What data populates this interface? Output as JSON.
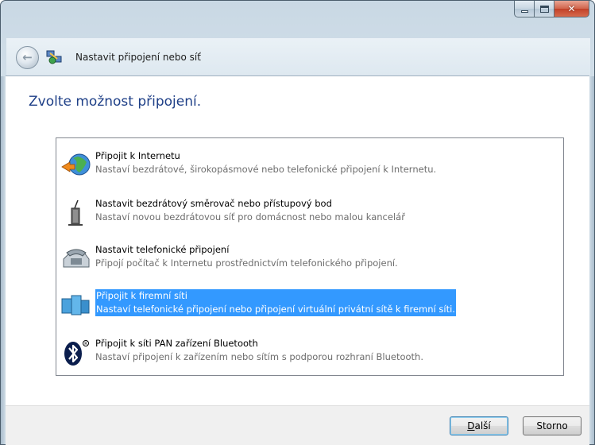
{
  "window": {
    "title": "Nastavit připojení nebo síť",
    "buttons": {
      "minimize": "minimize",
      "maximize": "maximize",
      "close": "close"
    }
  },
  "heading": "Zvolte možnost připojení.",
  "options": [
    {
      "title": "Připojit k Internetu",
      "desc": "Nastaví bezdrátové, širokopásmové nebo telefonické připojení k Internetu.",
      "icon": "globe-network-icon",
      "selected": false
    },
    {
      "title": "Nastavit bezdrátový směrovač nebo přístupový bod",
      "desc": "Nastaví novou bezdrátovou síť pro domácnost nebo malou kancelář",
      "icon": "router-icon",
      "selected": false
    },
    {
      "title": "Nastavit telefonické připojení",
      "desc": "Připojí počítač k Internetu prostřednictvím telefonického připojení.",
      "icon": "phone-icon",
      "selected": false
    },
    {
      "title": "Připojit k firemní síti",
      "desc": "Nastaví telefonické připojení nebo připojení virtuální privátní sítě k firemní síti.",
      "icon": "workplace-network-icon",
      "selected": true
    },
    {
      "title": "Připojit k síti PAN zařízení Bluetooth",
      "desc": "Nastaví připojení k zařízením nebo sítím s podporou rozhraní Bluetooth.",
      "icon": "bluetooth-icon",
      "selected": false
    }
  ],
  "buttons": {
    "next_underline": "D",
    "next_rest": "alší",
    "cancel": "Storno"
  },
  "colors": {
    "selection": "#3399ff",
    "heading": "#1e3f87"
  }
}
